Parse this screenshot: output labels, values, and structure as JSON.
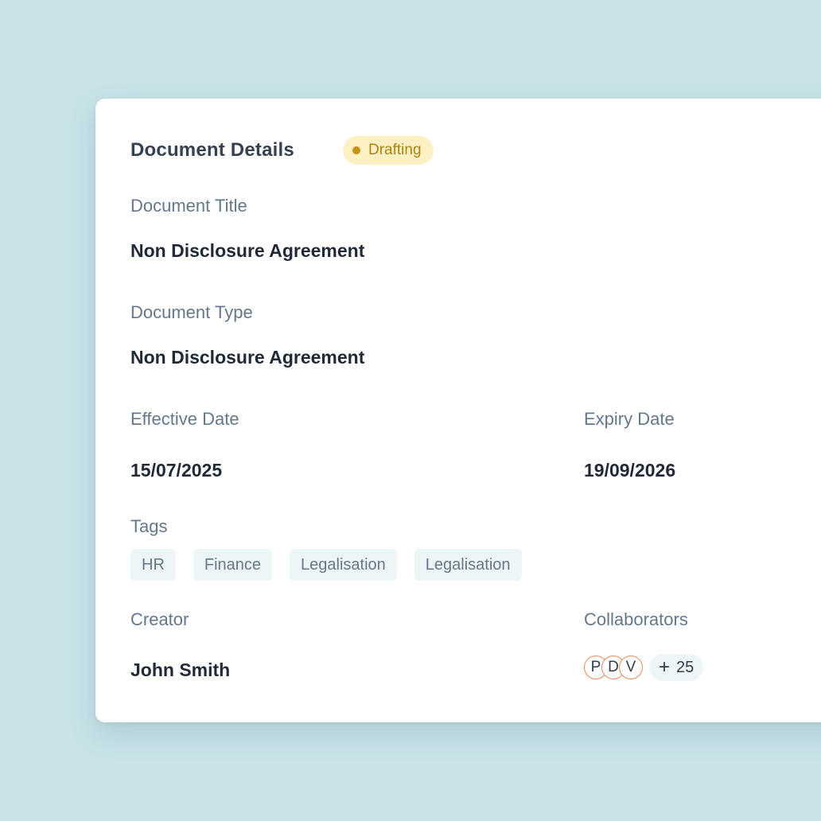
{
  "header": {
    "title": "Document Details",
    "status": "Drafting",
    "status_color": "#c9920c"
  },
  "fields": {
    "document_title_label": "Document Title",
    "document_title_value": "Non Disclosure Agreement",
    "document_type_label": "Document Type",
    "document_type_value": "Non Disclosure Agreement",
    "effective_date_label": "Effective Date",
    "effective_date_value": "15/07/2025",
    "expiry_date_label": "Expiry Date",
    "expiry_date_value": "19/09/2026",
    "tags_label": "Tags",
    "creator_label": "Creator",
    "creator_value": "John Smith",
    "collaborators_label": "Collaborators"
  },
  "tags": [
    "HR",
    "Finance",
    "Legalisation",
    "Legalisation"
  ],
  "collaborators": {
    "avatars": [
      "P",
      "D",
      "V"
    ],
    "more_count": "25",
    "avatar_border_color": "#e98a5a"
  }
}
